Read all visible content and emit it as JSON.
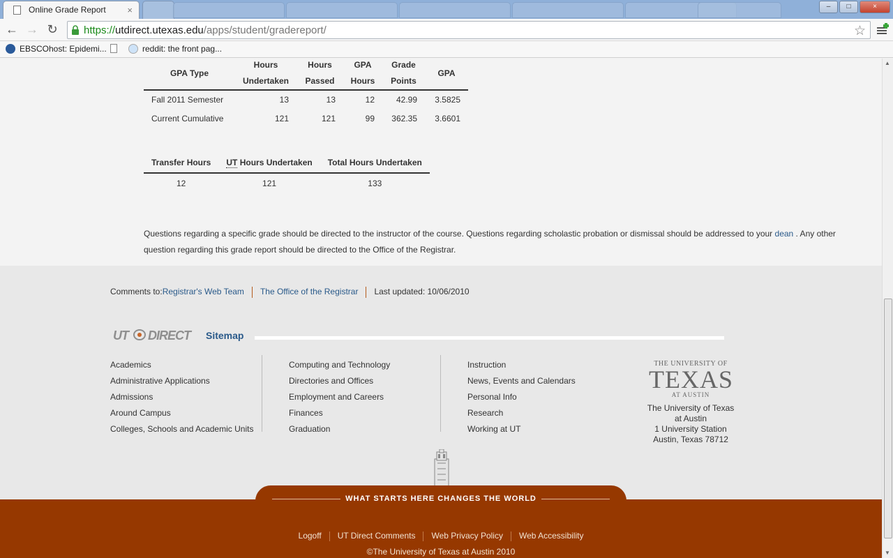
{
  "browser": {
    "active_tab_title": "Online Grade Report",
    "tab_close": "×",
    "url_scheme": "https://",
    "url_host": "utdirect.utexas.edu",
    "url_path": "/apps/student/gradereport/",
    "bookmarks": [
      "EBSCOhost: Epidemi...",
      "reddit: the front pag..."
    ],
    "window_buttons": [
      "–",
      "□",
      "×"
    ]
  },
  "gpa_table": {
    "headers": [
      [
        "GPA Type"
      ],
      [
        "Hours",
        "Undertaken"
      ],
      [
        "Hours",
        "Passed"
      ],
      [
        "GPA",
        "Hours"
      ],
      [
        "Grade",
        "Points"
      ],
      [
        "GPA"
      ]
    ],
    "rows": [
      {
        "type": "Fall 2011 Semester",
        "undertaken": "13",
        "passed": "13",
        "gpa_hours": "12",
        "grade_points": "42.99",
        "gpa": "3.5825"
      },
      {
        "type": "Current Cumulative",
        "undertaken": "121",
        "passed": "121",
        "gpa_hours": "99",
        "grade_points": "362.35",
        "gpa": "3.6601"
      }
    ]
  },
  "hours_table": {
    "h_transfer": "Transfer Hours",
    "h_ut_abbr": "UT",
    "h_ut_rest": " Hours Undertaken",
    "h_total": "Total Hours Undertaken",
    "transfer": "12",
    "ut": "121",
    "total": "133"
  },
  "note": {
    "text_1": "Questions regarding a specific grade should be directed to the instructor of the course. Questions regarding scholastic probation or dismissal should be addressed to your ",
    "dean_link": "dean",
    "text_2": " . Any other question regarding this grade report should be directed to the Office of the Registrar."
  },
  "footer": {
    "comments_label": "Comments to: ",
    "registrar_web_team": "Registrar's Web Team",
    "office_registrar": "The Office of the Registrar",
    "last_updated": "Last updated: 10/06/2010",
    "utd_logo": "UT DIRECT",
    "sitemap": "Sitemap",
    "col1": [
      "Academics",
      "Administrative Applications",
      "Admissions",
      "Around Campus",
      "Colleges, Schools and Academic Units"
    ],
    "col2": [
      "Computing and Technology",
      "Directories and Offices",
      "Employment and Careers",
      "Finances",
      "Graduation"
    ],
    "col3": [
      "Instruction",
      "News, Events and Calendars",
      "Personal Info",
      "Research",
      "Working at UT"
    ],
    "ut_wordmark_top": "THE UNIVERSITY OF",
    "ut_wordmark_big": "TEXAS",
    "ut_wordmark_bottom": "AT AUSTIN",
    "address": [
      "The University of Texas",
      "at Austin",
      "1 University Station",
      "Austin, Texas 78712"
    ],
    "slogan": "WHAT STARTS HERE CHANGES THE WORLD",
    "bottom_links": [
      "Logoff",
      "UT Direct Comments",
      "Web Privacy Policy",
      "Web Accessibility"
    ],
    "copyright": "©The University of Texas at Austin 2010"
  },
  "colors": {
    "burnt_orange": "#963800",
    "link_blue": "#2a5a8a",
    "url_green": "#1a8a1a"
  }
}
